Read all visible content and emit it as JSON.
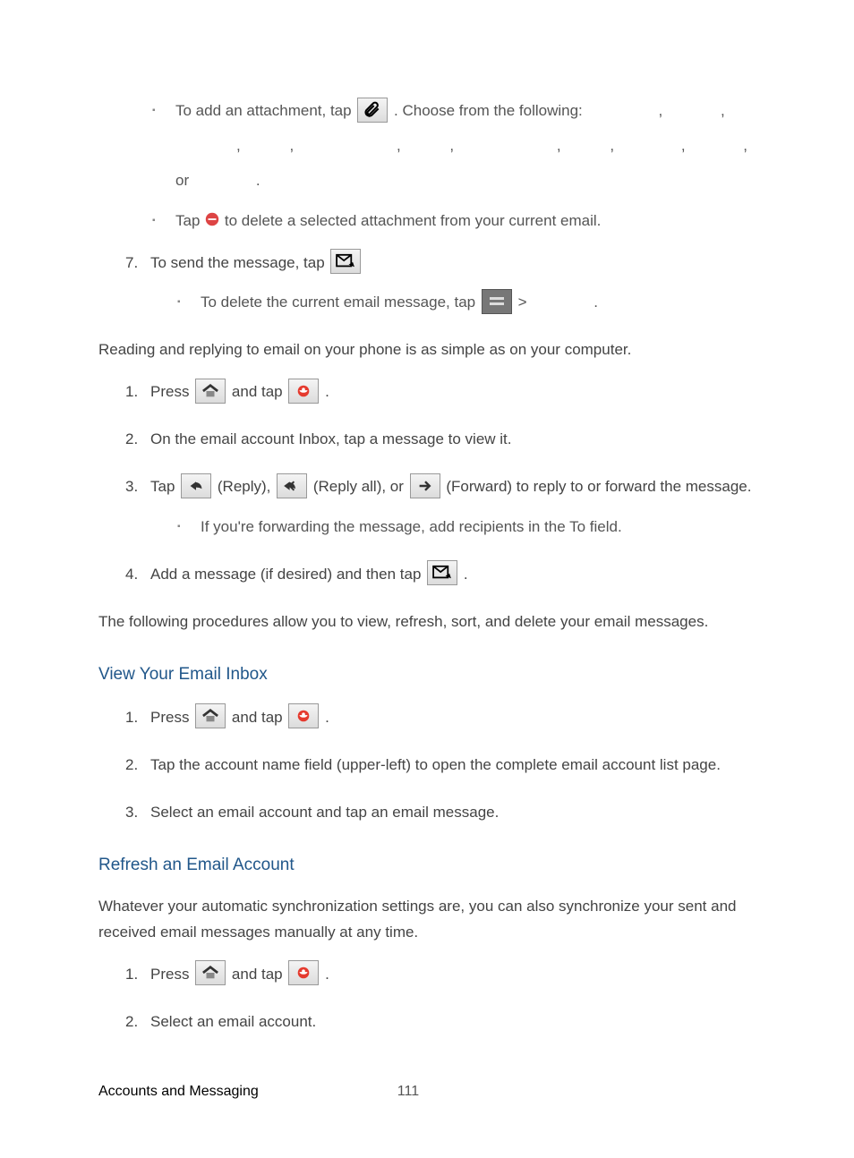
{
  "bullets_top": {
    "attach_part1": "To add an attachment, tap ",
    "attach_part2": ". Choose from the following:",
    "attach_or": "or",
    "delete_part1": "Tap ",
    "delete_part2": " to delete a selected attachment from your current email."
  },
  "steps_top": {
    "seven_num": "7.",
    "seven": "To send the message, tap ",
    "seven_sub_part1": "To delete the current email message, tap ",
    "seven_sub_part2": " >"
  },
  "para_reading": "Reading and replying to email on your phone is as simple as on your computer.",
  "read_steps": {
    "one_num": "1.",
    "one_part1": "Press ",
    "one_part2": " and tap ",
    "two_num": "2.",
    "two": "On the email account Inbox, tap a message to view it.",
    "three_num": "3.",
    "three_part1": "Tap ",
    "three_reply": " (Reply), ",
    "three_replyall": " (Reply all), or ",
    "three_forward": " (Forward) to reply to or forward the message.",
    "three_sub": "If you're forwarding the message, add recipients in the To field.",
    "four_num": "4.",
    "four": "Add a message (if desired) and then tap "
  },
  "para_procedures": "The following procedures allow you to view, refresh, sort, and delete your email messages.",
  "heading_view": "View Your Email Inbox",
  "view_steps": {
    "one_num": "1.",
    "one_part1": "Press ",
    "one_part2": " and tap ",
    "two_num": "2.",
    "two": "Tap the account name field (upper-left) to open the complete email account list page.",
    "three_num": "3.",
    "three": "Select an email account and tap an email message."
  },
  "heading_refresh": "Refresh an Email Account",
  "para_refresh": "Whatever your automatic synchronization settings are, you can also synchronize your sent and received email messages manually at any time.",
  "refresh_steps": {
    "one_num": "1.",
    "one_part1": "Press ",
    "one_part2": " and tap ",
    "two_num": "2.",
    "two": "Select an email account."
  },
  "footer": {
    "section": "Accounts and Messaging",
    "page": "111"
  },
  "commas": {
    "c": ","
  }
}
